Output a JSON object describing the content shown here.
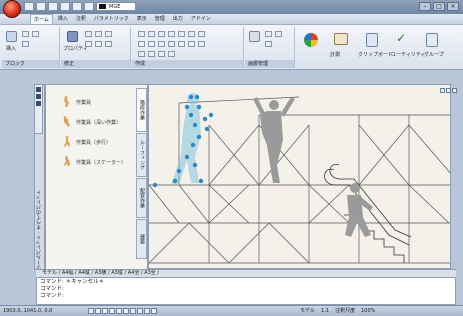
{
  "titlebar": {
    "app_button": "application-menu",
    "workspace_dropdown": "MGE",
    "window_controls": [
      "–",
      "□",
      "×"
    ]
  },
  "menubar": {
    "tabs": [
      "ホーム",
      "挿入",
      "注釈",
      "パラメトリック",
      "表示",
      "管理",
      "出力",
      "アドイン"
    ],
    "active_index": 0
  },
  "ribbon": {
    "panels": [
      {
        "label": "ブロック"
      },
      {
        "label": "修正"
      },
      {
        "label": "作成"
      },
      {
        "label": "画層管理"
      },
      {
        "label": "ユーティリティ"
      }
    ],
    "buttons": [
      "挿入",
      "プロパティ",
      "計測",
      "クリップボード",
      "ユーティリティ",
      "グループ"
    ]
  },
  "palette": {
    "title": "ツールパレット - すべてのパレット",
    "items": [
      {
        "label": "作業員"
      },
      {
        "label": "作業員（深い作業）"
      },
      {
        "label": "作業員（歩行）"
      },
      {
        "label": "作業員（スケーター）"
      }
    ],
    "tabs": [
      "階段作業",
      "ルーフィング",
      "配管作業",
      "建築"
    ]
  },
  "layout_tabs": "モデル / A4幅 / A4縦 / A3横 / A3縦 / A4全 / A3全 /",
  "command_lines": [
    "コマンド: ＊キャンセル＊",
    "コマンド:",
    "コマンド:"
  ],
  "status": {
    "coords": "1903.0, 1041.0, 0.0",
    "right_items": [
      "モデル",
      "1:1",
      "注釈尺度",
      "100%"
    ]
  }
}
